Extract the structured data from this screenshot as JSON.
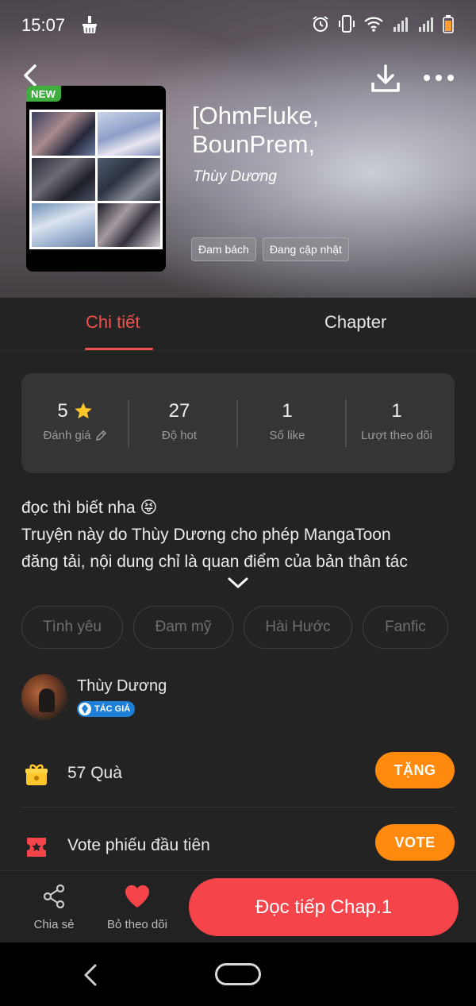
{
  "status": {
    "time": "15:07"
  },
  "book": {
    "badge": "NEW",
    "title_line1": "[OhmFluke,",
    "title_line2": "BounPrem,",
    "author": "Thùy Dương",
    "chips": [
      "Đam bách",
      "Đang cập nhật"
    ]
  },
  "tabs": {
    "detail": "Chi tiết",
    "chapter": "Chapter"
  },
  "stats": {
    "rating": {
      "value": "5",
      "label": "Đánh giá"
    },
    "hot": {
      "value": "27",
      "label": "Độ hot"
    },
    "likes": {
      "value": "1",
      "label": "Số like"
    },
    "follows": {
      "value": "1",
      "label": "Lượt theo dõi"
    }
  },
  "description": {
    "line1": "đọc thì biết nha 😝",
    "line2": "Truyện này do Thùy Dương cho phép MangaToon",
    "line3": "đăng tải, nội dung chỉ là quan điểm của bản thân tác"
  },
  "genres": [
    "Tình yêu",
    "Đam mỹ",
    "Hài Hước",
    "Fanfic"
  ],
  "author": {
    "name": "Thùy Dương",
    "badge": "TÁC GIẢ"
  },
  "gift": {
    "text": "57  Quà",
    "button": "TẶNG"
  },
  "vote": {
    "text": "Vote phiếu đầu tiên",
    "button": "VOTE"
  },
  "bottom": {
    "share": "Chia sẻ",
    "unfollow": "Bỏ theo dõi",
    "read": "Đọc tiếp Chap.1"
  },
  "colors": {
    "accent": "#f5454a",
    "orange": "#ff8a0d",
    "background": "#232323",
    "new_badge": "#3fae3f",
    "author_badge": "#1e7fd8"
  },
  "icons": [
    "back-arrow-icon",
    "download-icon",
    "more-icon",
    "star-icon",
    "pencil-icon",
    "chevron-down-icon",
    "gift-icon",
    "ticket-icon",
    "share-icon",
    "heart-icon"
  ]
}
